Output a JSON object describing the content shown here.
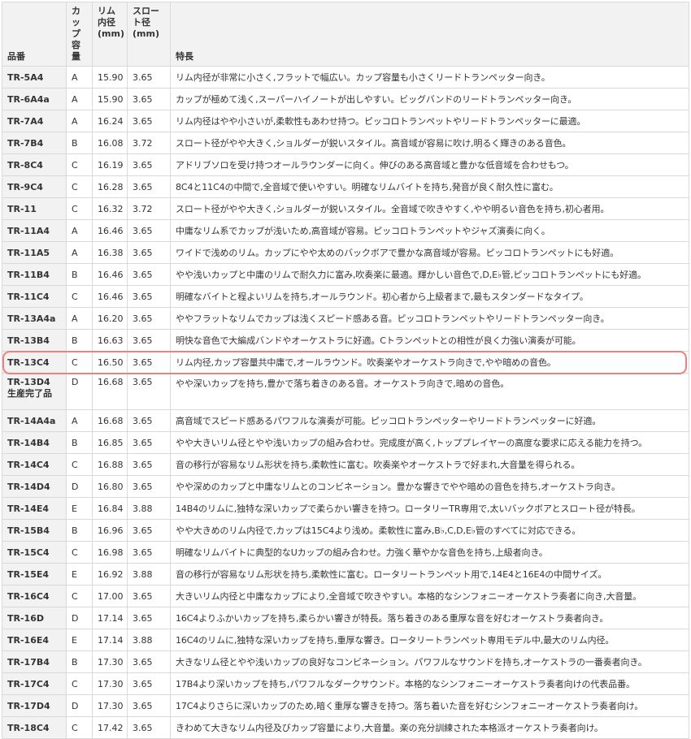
{
  "headers": {
    "model": "品番",
    "cup_1": "カップ",
    "cup_2": "容量",
    "rim_1": "リム内径",
    "rim_2": "(mm)",
    "throat_1": "スロート径",
    "throat_2": "(mm)",
    "features": "特長"
  },
  "rows": [
    {
      "model": "TR-5A4",
      "cup": "A",
      "rim": "15.90",
      "throat": "3.65",
      "features": "リム内径が非常に小さく,フラットで幅広い。カップ容量も小さくリードトランペッター向き。"
    },
    {
      "model": "TR-6A4a",
      "cup": "A",
      "rim": "15.90",
      "throat": "3.65",
      "features": "カップが極めて浅く,スーパーハイノートが出しやすい。ビッグバンドのリードトランペッター向き。"
    },
    {
      "model": "TR-7A4",
      "cup": "A",
      "rim": "16.24",
      "throat": "3.65",
      "features": "リム内径はやや小さいが,柔軟性もあわせ持つ。ピッコロトランペットやリードトランペッターに最適。"
    },
    {
      "model": "TR-7B4",
      "cup": "B",
      "rim": "16.08",
      "throat": "3.72",
      "features": "スロート径がやや大きく,ショルダーが鋭いスタイル。高音域が容易に吹け,明るく輝きのある音色。"
    },
    {
      "model": "TR-8C4",
      "cup": "C",
      "rim": "16.19",
      "throat": "3.65",
      "features": "アドリブソロを受け持つオールラウンダーに向く。伸びのある高音域と豊かな低音域を合わせもつ。"
    },
    {
      "model": "TR-9C4",
      "cup": "C",
      "rim": "16.28",
      "throat": "3.65",
      "features": "8C4と11C4の中間で,全音域で使いやすい。明確なリムバイトを持ち,発音が良く耐久性に富む。"
    },
    {
      "model": "TR-11",
      "cup": "C",
      "rim": "16.32",
      "throat": "3.72",
      "features": "スロート径がやや大きく,ショルダーが鋭いスタイル。全音域で吹きやすく,やや明るい音色を持ち,初心者用。"
    },
    {
      "model": "TR-11A4",
      "cup": "A",
      "rim": "16.46",
      "throat": "3.65",
      "features": "中庸なリム系でカップが浅いため,高音域が容易。ピッコロトランペットやジャズ演奏に向く。"
    },
    {
      "model": "TR-11A5",
      "cup": "A",
      "rim": "16.38",
      "throat": "3.65",
      "features": "ワイドで浅めのリム。カップにやや太めのバックボアで豊かな高音域が容易。ピッコロトランペットにも好適。"
    },
    {
      "model": "TR-11B4",
      "cup": "B",
      "rim": "16.46",
      "throat": "3.65",
      "features": "やや浅いカップと中庸のリムで耐久力に富み,吹奏楽に最適。輝かしい音色で,D,E♭管,ピッコロトランペットにも好適。"
    },
    {
      "model": "TR-11C4",
      "cup": "C",
      "rim": "16.46",
      "throat": "3.65",
      "features": "明確なバイトと程よいリムを持ち,オールラウンド。初心者から上級者まで,最もスタンダードなタイプ。"
    },
    {
      "model": "TR-13A4a",
      "cup": "A",
      "rim": "16.20",
      "throat": "3.65",
      "features": "ややフラットなリムでカップは浅くスピード感ある音。ピッコロトランペットやリードトランペッター向き。"
    },
    {
      "model": "TR-13B4",
      "cup": "B",
      "rim": "16.63",
      "throat": "3.65",
      "features": "明快な音色で大編成バンドやオーケストラに好適。Cトランペットとの相性が良く力強い演奏が可能。"
    },
    {
      "model": "TR-13C4",
      "cup": "C",
      "rim": "16.50",
      "throat": "3.65",
      "features": "リム内径,カップ容量共中庸で,オールラウンド。吹奏楽やオーケストラ向きで,やや暗めの音色。"
    },
    {
      "model": "TR-13D4",
      "model_note": "生産完了品",
      "cup": "D",
      "rim": "16.68",
      "throat": "3.65",
      "features": "やや深いカップを持ち,豊かで落ち着きのある音。オーケストラ向きで,暗めの音色。"
    },
    {
      "model": "TR-14A4a",
      "cup": "A",
      "rim": "16.68",
      "throat": "3.65",
      "features": "高音域でスピード感あるパワフルな演奏が可能。ピッコロトランペッターやリードトランペッターに好適。"
    },
    {
      "model": "TR-14B4",
      "cup": "B",
      "rim": "16.85",
      "throat": "3.65",
      "features": "やや大きいリム径とやや浅いカップの組み合わせ。完成度が高く,トッププレイヤーの高度な要求に応える能力を持つ。"
    },
    {
      "model": "TR-14C4",
      "cup": "C",
      "rim": "16.88",
      "throat": "3.65",
      "features": "音の移行が容易なリム形状を持ち,柔軟性に富む。吹奏楽やオーケストラで好まれ,大音量を得られる。"
    },
    {
      "model": "TR-14D4",
      "cup": "D",
      "rim": "16.80",
      "throat": "3.65",
      "features": "やや深めのカップと中庸なリムとのコンビネーション。豊かな響きでやや暗めの音色を持ち,オーケストラ向き。"
    },
    {
      "model": "TR-14E4",
      "cup": "E",
      "rim": "16.84",
      "throat": "3.88",
      "features": "14B4のリムに,独特な深いカップで柔らかい響きを持つ。ロータリーTR専用で,太いバックボアとスロート径が特長。"
    },
    {
      "model": "TR-15B4",
      "cup": "B",
      "rim": "16.96",
      "throat": "3.65",
      "features": "やや大きめのリム内径で,カップは15C4より浅め。柔軟性に富み,B♭,C,D,E♭管のすべてに対応できる。"
    },
    {
      "model": "TR-15C4",
      "cup": "C",
      "rim": "16.98",
      "throat": "3.65",
      "features": "明確なリムバイトに典型的なUカップの組み合わせ。力強く華やかな音色を持ち,上級者向き。"
    },
    {
      "model": "TR-15E4",
      "cup": "E",
      "rim": "16.92",
      "throat": "3.88",
      "features": "音の移行が容易なリム形状を持ち,柔軟性に富む。ロータリートランペット用で,14E4と16E4の中間サイズ。"
    },
    {
      "model": "TR-16C4",
      "cup": "C",
      "rim": "17.00",
      "throat": "3.65",
      "features": "大きいリム内径と中庸なカップにより,全音域で吹きやすい。本格的なシンフォニーオーケストラ奏者に向き,大音量。"
    },
    {
      "model": "TR-16D",
      "cup": "D",
      "rim": "17.14",
      "throat": "3.65",
      "features": "16C4よりふかいカップを持ち,柔らかい響きが特長。落ち着きのある重厚な音を好むオーケストラ奏者向き。"
    },
    {
      "model": "TR-16E4",
      "cup": "E",
      "rim": "17.14",
      "throat": "3.88",
      "features": "16C4のリムに,独特な深いカップを持ち,重厚な響き。ロータリートランペット専用モデル中,最大のリム内径。"
    },
    {
      "model": "TR-17B4",
      "cup": "B",
      "rim": "17.30",
      "throat": "3.65",
      "features": "大きなリム径とやや浅いカップの良好なコンビネーション。パワフルなサウンドを持ち,オーケストラの一番奏者向き。"
    },
    {
      "model": "TR-17C4",
      "cup": "C",
      "rim": "17.30",
      "throat": "3.65",
      "features": "17B4より深いカップを持ち,パワフルなダークサウンド。本格的なシンフォニーオーケストラ奏者向けの代表品番。"
    },
    {
      "model": "TR-17D4",
      "cup": "D",
      "rim": "17.30",
      "throat": "3.65",
      "features": "17C4よりさらに深いカップのため,暗く重厚な響きを持つ。落ち着いた音を好むシンフォニーオーケストラ奏者向け。"
    },
    {
      "model": "TR-18C4",
      "cup": "C",
      "rim": "17.42",
      "throat": "3.65",
      "features": "きわめて大きなリム内径及びカップ容量により,大音量。楽の充分訓練された本格派オーケストラ奏者向け。"
    }
  ],
  "highlighted_model": "TR-13C4",
  "colors": {
    "header_bg": "#f2f2f2",
    "border": "#d9d9d9",
    "highlight": "#f08080"
  }
}
